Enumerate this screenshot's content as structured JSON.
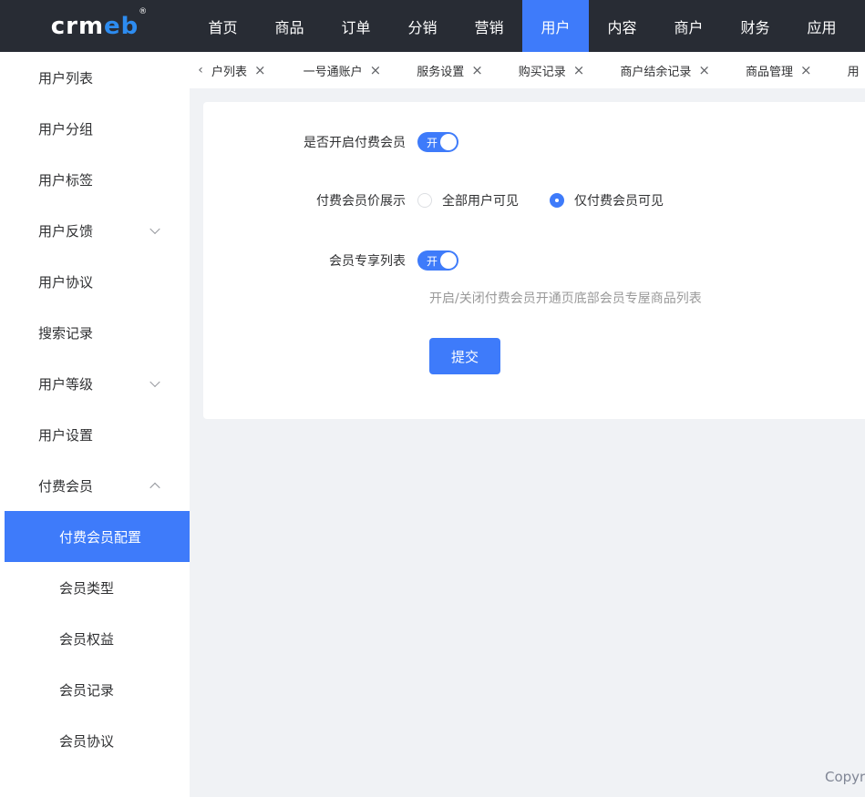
{
  "logo": {
    "text_main": "crm",
    "text_accent": "eb",
    "reg": "®"
  },
  "topnav": [
    "首页",
    "商品",
    "订单",
    "分销",
    "营销",
    "用户",
    "内容",
    "商户",
    "财务",
    "应用"
  ],
  "topnav_active_index": 5,
  "sidebar": {
    "items": [
      {
        "label": "用户列表"
      },
      {
        "label": "用户分组"
      },
      {
        "label": "用户标签"
      },
      {
        "label": "用户反馈"
      },
      {
        "label": "用户协议"
      },
      {
        "label": "搜索记录"
      },
      {
        "label": "用户等级"
      },
      {
        "label": "用户设置"
      },
      {
        "label": "付费会员"
      }
    ],
    "sub_items": [
      {
        "label": "付费会员配置"
      },
      {
        "label": "会员类型"
      },
      {
        "label": "会员权益"
      },
      {
        "label": "会员记录"
      },
      {
        "label": "会员协议"
      }
    ]
  },
  "tabs": [
    {
      "label": "户列表"
    },
    {
      "label": "一号通账户"
    },
    {
      "label": "服务设置"
    },
    {
      "label": "购买记录"
    },
    {
      "label": "商户结余记录"
    },
    {
      "label": "商品管理"
    },
    {
      "label": "用"
    }
  ],
  "tabs_prev_icon": "‹",
  "tab_close_icon": "×",
  "form": {
    "enable_label": "是否开启付费会员",
    "enable_switch_text": "开",
    "price_label": "付费会员价展示",
    "price_option_all": "全部用户可见",
    "price_option_paid": "仅付费会员可见",
    "exclusive_label": "会员专享列表",
    "exclusive_switch_text": "开",
    "exclusive_hint": "开启/关闭付费会员开通页底部会员专屋商品列表",
    "submit_label": "提交"
  },
  "footer": {
    "copyright": "Copyri"
  },
  "colors": {
    "primary": "#3e7bfa",
    "topbar": "#282c34",
    "background": "#f0f2f5"
  }
}
